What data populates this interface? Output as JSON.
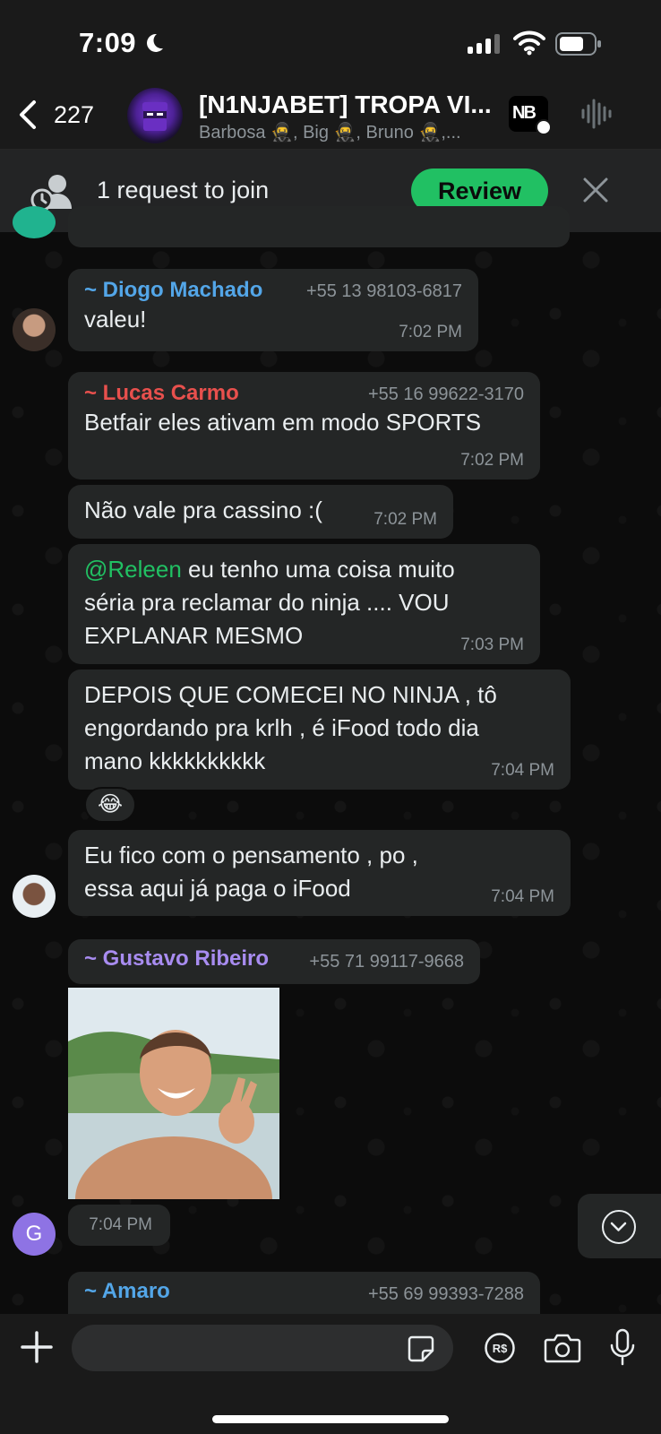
{
  "status_bar": {
    "time": "7:09"
  },
  "header": {
    "back_count": "227",
    "title": "[N1NJABET] TROPA VI...",
    "subtitle": "Barbosa 🥷, Big 🥷, Bruno 🥷,..."
  },
  "join_banner": {
    "text": "1 request to join",
    "review_label": "Review"
  },
  "messages": [
    {
      "sender": "~ Diogo Machado",
      "sender_color": "#53a6e8",
      "phone": "+55 13 98103-6817",
      "text": "valeu!",
      "time": "7:02 PM"
    },
    {
      "sender": "~ Lucas Carmo",
      "sender_color": "#e8504d",
      "phone": "+55 16 99622-3170",
      "text": "Betfair eles ativam em modo SPORTS",
      "time": "7:02 PM"
    },
    {
      "text": "Não vale pra cassino :(",
      "time": "7:02 PM"
    },
    {
      "mention": "@Releen",
      "text": " eu tenho uma coisa muito séria pra reclamar do ninja .... VOU EXPLANAR MESMO",
      "time": "7:03 PM"
    },
    {
      "text": "DEPOIS QUE COMECEI NO NINJA , tô engordando pra krlh , é iFood todo dia mano kkkkkkkkkk",
      "time": "7:04 PM",
      "reaction": "😂"
    },
    {
      "text": "Eu fico com o pensamento , po , essa aqui já paga o iFood",
      "time": "7:04 PM"
    },
    {
      "sender": "~ Gustavo Ribeiro",
      "sender_color": "#a88cf0",
      "phone": "+55 71 99117-9668",
      "time": "7:04 PM",
      "avatar_letter": "G"
    },
    {
      "sender": "~ Amaro",
      "sender_color": "#53a6e8",
      "phone": "+55 69 99393-7288"
    }
  ],
  "input": {
    "placeholder": ""
  },
  "colors": {
    "accent": "#21c063",
    "bubble": "#242626",
    "background": "#0c0c0c"
  }
}
